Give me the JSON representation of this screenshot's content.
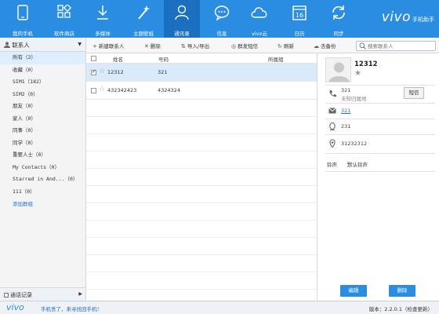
{
  "app": {
    "brand": "vivo",
    "brand_tag": "手机助手"
  },
  "nav": {
    "items": [
      {
        "label": "我的手机",
        "icon": "phone-icon"
      },
      {
        "label": "软件商店",
        "icon": "app-grid-icon"
      },
      {
        "label": "多媒体",
        "icon": "download-icon"
      },
      {
        "label": "主题壁纸",
        "icon": "magic-wand-icon"
      },
      {
        "label": "通讯录",
        "icon": "contacts-icon"
      },
      {
        "label": "信息",
        "icon": "message-icon"
      },
      {
        "label": "vivo云",
        "icon": "cloud-icon"
      },
      {
        "label": "日历",
        "icon": "calendar-icon",
        "day": "16"
      },
      {
        "label": "同步",
        "icon": "sync-icon"
      }
    ],
    "active_index": 4
  },
  "sidebar": {
    "title": "联系人",
    "groups": [
      "所有（2）",
      "收藏（0）",
      "SIM1（182）",
      "SIM2（0）",
      "朋友（0）",
      "家人（0）",
      "同事（0）",
      "同学（0）",
      "重要人士（0）",
      "My Contacts（0）",
      "Starred in And...（0）",
      "111（0）"
    ],
    "active_group": 0,
    "add_group": "添加群组",
    "footer": "通话记录"
  },
  "toolbar": {
    "new_contact": "新建联系人",
    "delete": "删除",
    "import_export": "导入/导出",
    "group_sms": "群发短信",
    "refresh": "刷新",
    "backup": "去备份",
    "search_placeholder": "搜索联系人"
  },
  "list": {
    "columns": {
      "name": "姓名",
      "phone": "号码",
      "group": "所属组"
    },
    "rows": [
      {
        "name": "12312",
        "phone": "321",
        "selected": true
      },
      {
        "name": "432342423",
        "phone": "4324324",
        "selected": false
      }
    ]
  },
  "detail": {
    "name": "12312",
    "phone": "321",
    "phone_location": "未知归属地",
    "sms_button": "短信",
    "email": "321",
    "qq": "231",
    "address": "31232312",
    "ringtone_label": "铃声",
    "ringtone_value": "默认铃声",
    "edit_button": "编辑",
    "delete_button": "删除"
  },
  "status": {
    "logo": "vivo",
    "message": "手机丢了，来寻找回手机！",
    "version": "版本：2.2.0.1（检查更新）"
  },
  "colors": {
    "accent": "#2a8de2",
    "accent_dark": "#1b6fc0",
    "selection": "#d9ebfb"
  }
}
